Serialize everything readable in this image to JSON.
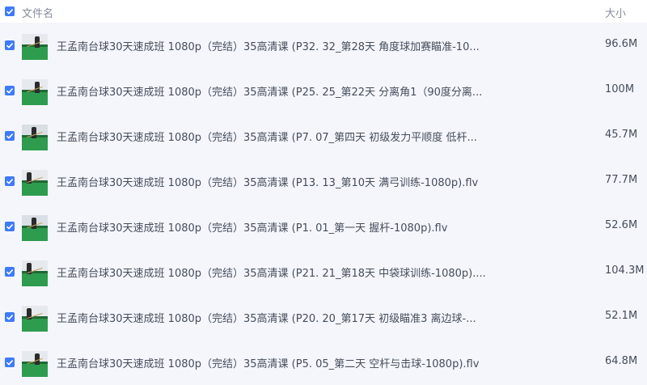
{
  "header": {
    "name_label": "文件名",
    "size_label": "大小"
  },
  "files": [
    {
      "name": "王孟南台球30天速成班 1080p（完结）35高清课 (P32. 32_第28天 角度球加赛瞄准-10...",
      "size": "96.6M"
    },
    {
      "name": "王孟南台球30天速成班 1080p（完结）35高清课 (P25. 25_第22天 分离角1（90度分离...",
      "size": "100M"
    },
    {
      "name": "王孟南台球30天速成班 1080p（完结）35高清课 (P7. 07_第四天 初级发力平顺度 低杆...",
      "size": "45.7M"
    },
    {
      "name": "王孟南台球30天速成班 1080p（完结）35高清课 (P13. 13_第10天 满弓训练-1080p).flv",
      "size": "77.7M"
    },
    {
      "name": "王孟南台球30天速成班 1080p（完结）35高清课 (P1. 01_第一天 握杆-1080p).flv",
      "size": "52.6M"
    },
    {
      "name": "王孟南台球30天速成班 1080p（完结）35高清课 (P21. 21_第18天 中袋球训练-1080p)....",
      "size": "104.3M"
    },
    {
      "name": "王孟南台球30天速成班 1080p（完结）35高清课 (P20. 20_第17天 初级瞄准3 离边球-...",
      "size": "52.1M"
    },
    {
      "name": "王孟南台球30天速成班 1080p（完结）35高清课 (P5. 05_第二天 空杆与击球-1080p).flv",
      "size": "64.8M"
    }
  ]
}
